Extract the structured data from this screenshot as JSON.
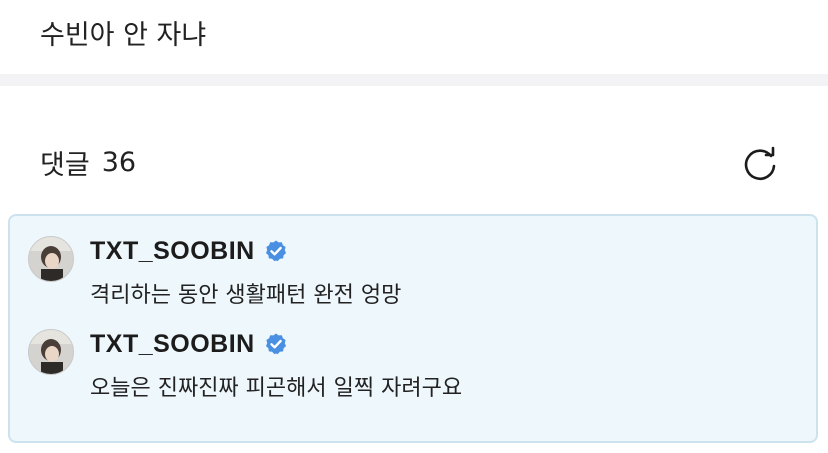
{
  "post": {
    "text": "수빈아 안 자냐"
  },
  "comments": {
    "label": "댓글",
    "count": "36",
    "refresh_icon": "refresh-icon",
    "items": [
      {
        "username": "TXT_SOOBIN",
        "verified": true,
        "text": "격리하는 동안 생활패턴 완전 엉망"
      },
      {
        "username": "TXT_SOOBIN",
        "verified": true,
        "text": "오늘은 진짜진짜 피곤해서 일찍 자려구요"
      }
    ]
  },
  "colors": {
    "highlight_bg": "#edf7fc",
    "highlight_border": "#cce3ee",
    "verified_blue": "#4a90e2",
    "divider": "#f3f3f6"
  }
}
